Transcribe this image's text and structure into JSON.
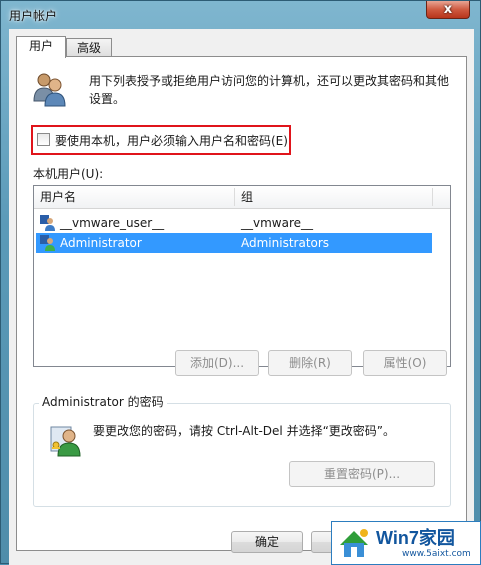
{
  "window": {
    "title": "用户帐户",
    "close_glyph": "x"
  },
  "tabs": [
    {
      "label": "用户",
      "active": true
    },
    {
      "label": "高级",
      "active": false
    }
  ],
  "description": "用下列表授予或拒绝用户访问您的计算机，还可以更改其密码和其他设置。",
  "require_login": {
    "label": "要使用本机，用户必须输入用户名和密码(E)",
    "checked": false,
    "highlight_color": "#e0141b"
  },
  "users_list": {
    "label": "本机用户(U):",
    "columns": [
      "用户名",
      "组"
    ],
    "rows": [
      {
        "name": "__vmware_user__",
        "group": "__vmware__",
        "selected": false
      },
      {
        "name": "Administrator",
        "group": "Administrators",
        "selected": true
      }
    ],
    "selection_color": "#3399ff"
  },
  "list_buttons": {
    "add": "添加(D)...",
    "remove": "删除(R)",
    "properties": "属性(O)"
  },
  "password_group": {
    "title": "Administrator 的密码",
    "text": "要更改您的密码，请按 Ctrl-Alt-Del 并选择“更改密码”。",
    "reset_button": "重置密码(P)..."
  },
  "footer": {
    "ok_button": "确定"
  },
  "watermark": {
    "title": "Win7家园",
    "url": "www.5aixt.com"
  },
  "icons": {
    "users": "users-icon",
    "user_row": "user-icon",
    "password": "key-user-icon",
    "close": "close-icon"
  }
}
